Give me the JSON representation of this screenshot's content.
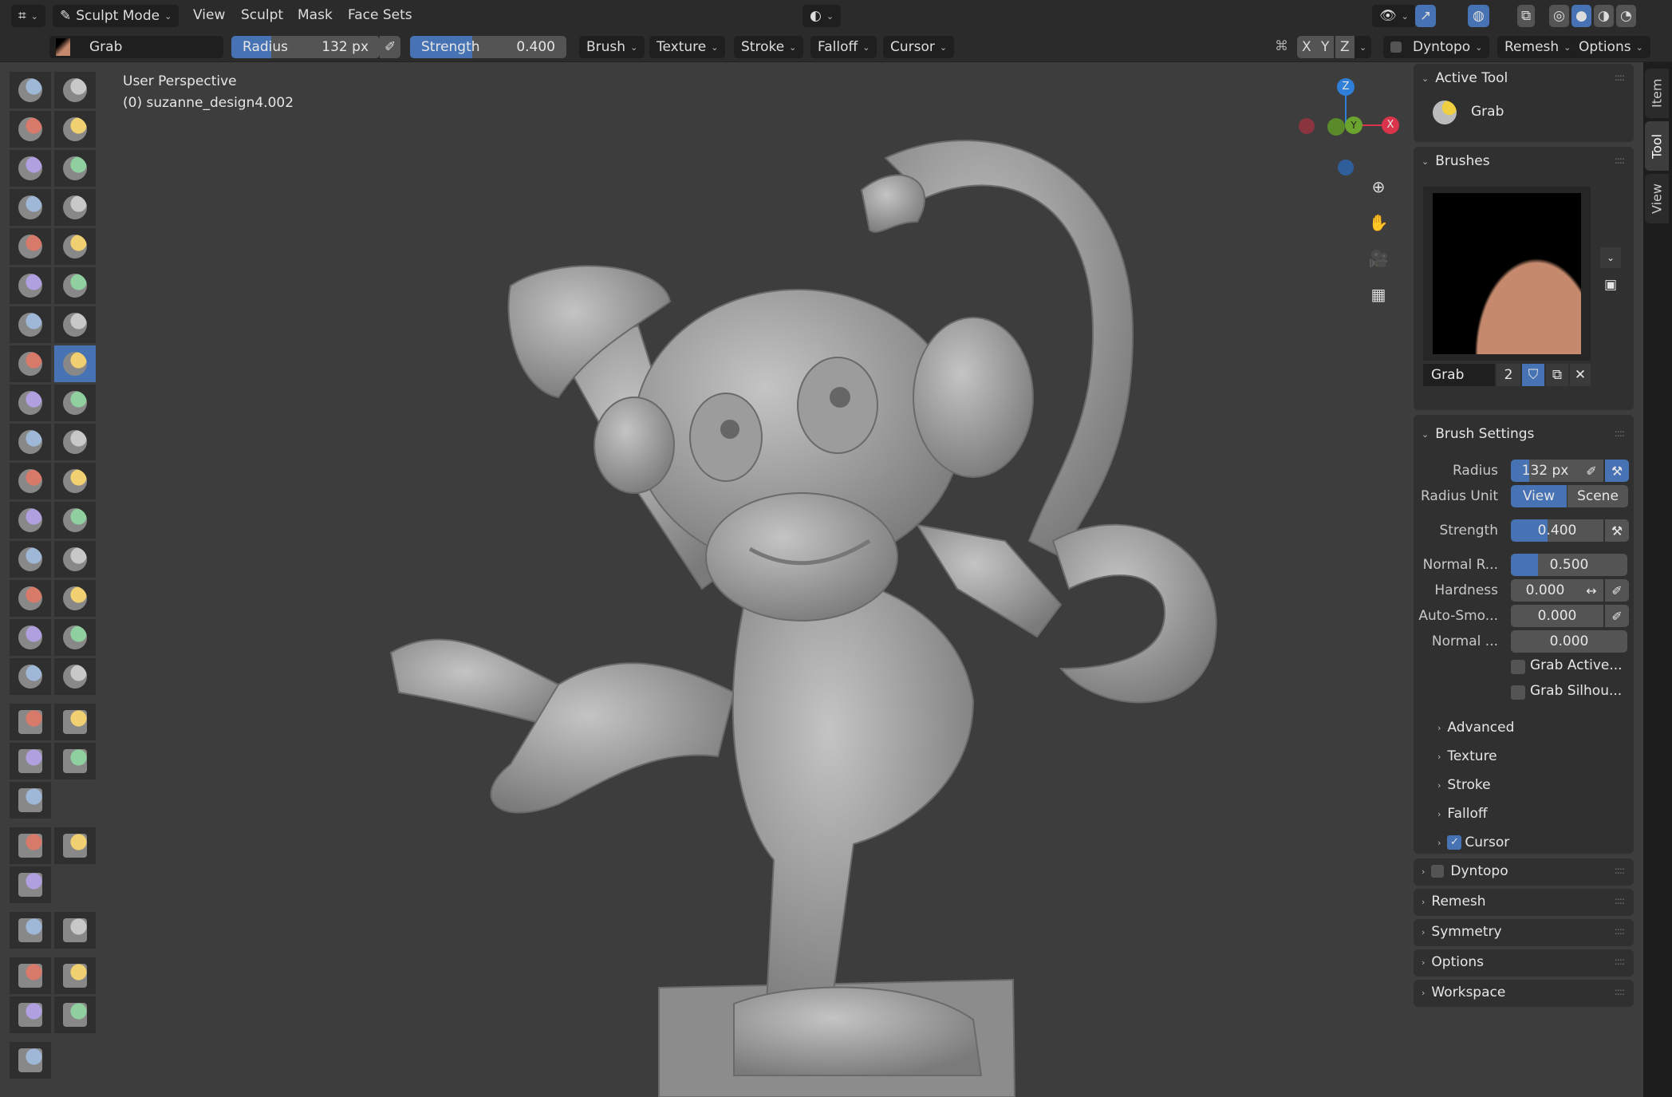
{
  "header": {
    "mode": "Sculpt Mode",
    "menus": [
      "View",
      "Sculpt",
      "Mask",
      "Face Sets"
    ],
    "brush_name": "Grab",
    "radius_label": "Radius",
    "radius_value": "132 px",
    "radius_fraction": 0.27,
    "strength_label": "Strength",
    "strength_value": "0.400",
    "strength_fraction": 0.4,
    "dropdowns": [
      "Brush",
      "Texture",
      "Stroke",
      "Falloff",
      "Cursor"
    ],
    "axes": [
      "X",
      "Y",
      "Z"
    ],
    "right_dropdowns": [
      "Dyntopo",
      "Remesh",
      "Options"
    ]
  },
  "viewport": {
    "view_name": "User Perspective",
    "object_name": "(0) suzanne_design4.002",
    "gizmo": {
      "z": "Z",
      "y": "Y",
      "x": "X"
    },
    "nav_icons": [
      "zoom-icon",
      "pan-hand-icon",
      "camera-icon",
      "grid-ortho-icon"
    ]
  },
  "tools": [
    "draw",
    "draw-sharp",
    "clay",
    "clay-strips",
    "clay-thumb",
    "layer",
    "inflate",
    "blob",
    "crease",
    "smooth",
    "flatten",
    "fill",
    "scrape",
    "multiplane-scrape",
    "pinch",
    "grab",
    "elastic-deform",
    "snake-hook",
    "thumb",
    "pose",
    "nudge",
    "rotate",
    "slide-relax",
    "boundary",
    "cloth",
    "simplify",
    "mask",
    "draw-face-sets",
    "multires-eraser",
    "multires-smear",
    "paint",
    "smear",
    "box-mask",
    "box-hide",
    "box-face-set",
    "box-trim",
    "line-project",
    "",
    "mesh-filter",
    "cloth-filter",
    "color-filter",
    "",
    "edit-face-set",
    "mask-by-color",
    "move",
    "rotate",
    "scale",
    "transform",
    "annotate",
    ""
  ],
  "panel": {
    "active_tool": {
      "title": "Active Tool",
      "name": "Grab"
    },
    "brushes": {
      "title": "Brushes",
      "name": "Grab",
      "users": "2"
    },
    "brush_settings": {
      "title": "Brush Settings",
      "radius": {
        "label": "Radius",
        "value": "132 px",
        "fraction": 0.27
      },
      "radius_unit": {
        "label": "Radius Unit",
        "options": [
          "View",
          "Scene"
        ],
        "selected": "View"
      },
      "strength": {
        "label": "Strength",
        "value": "0.400",
        "fraction": 0.4
      },
      "normal_radius": {
        "label": "Normal R...",
        "value": "0.500",
        "fraction": 0.5
      },
      "hardness": {
        "label": "Hardness",
        "value": "0.000"
      },
      "auto_smooth": {
        "label": "Auto-Smo...",
        "value": "0.000"
      },
      "normal_weight": {
        "label": "Normal ...",
        "value": "0.000"
      },
      "grab_active": {
        "label": "Grab Active...",
        "checked": false
      },
      "grab_silhouette": {
        "label": "Grab Silhou...",
        "checked": false
      }
    },
    "subpanels": [
      "Advanced",
      "Texture",
      "Stroke",
      "Falloff",
      "Cursor"
    ],
    "cursor_checked": true,
    "sections": [
      "Dyntopo",
      "Remesh",
      "Symmetry",
      "Options",
      "Workspace"
    ],
    "dyntopo_checked": false
  },
  "tabs": [
    "Item",
    "Tool",
    "View"
  ],
  "colors": {
    "accent": "#4772b3",
    "viewport": "#3d3d3d",
    "model": "#a8a8a8"
  }
}
